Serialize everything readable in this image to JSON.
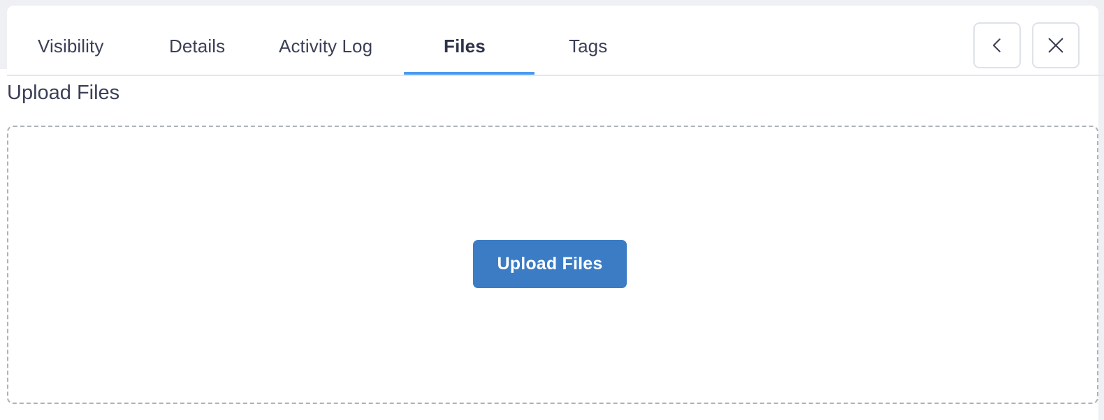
{
  "header": {
    "tabs": [
      {
        "label": "Visibility",
        "active": false
      },
      {
        "label": "Details",
        "active": false
      },
      {
        "label": "Activity Log",
        "active": false
      },
      {
        "label": "Files",
        "active": true
      },
      {
        "label": "Tags",
        "active": false
      }
    ],
    "actions": [
      {
        "name": "back-button",
        "icon": "chevron-left-icon",
        "label": ""
      },
      {
        "name": "close-button",
        "icon": "close-icon",
        "label": ""
      }
    ]
  },
  "content": {
    "section_title": "Upload Files",
    "dropzone": {
      "upload_button_label": "Upload Files"
    }
  },
  "colors": {
    "accent": "#4a9af0",
    "button": "#3b7cc4",
    "text": "#3b3f56",
    "page_background": "#eef0f3",
    "card_background": "#ffffff",
    "dropzone_border": "#adb2ba",
    "divider": "#e3e7ee",
    "icon_button_border": "#dde2ea"
  }
}
